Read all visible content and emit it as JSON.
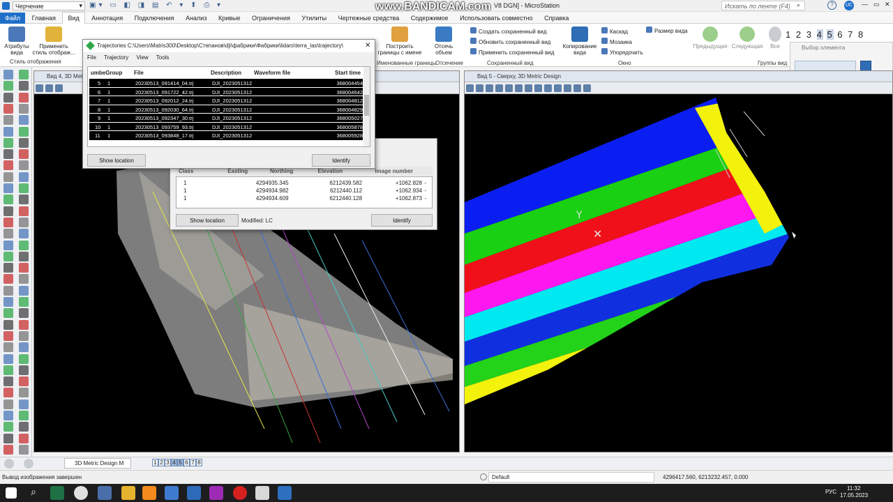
{
  "titlebar": {
    "workflow": "Черчение",
    "title": "V8 DGN] - MicroStation",
    "watermark": "www.BANDICAM.com",
    "search_placeholder": "Искать по ленте (F4)",
    "user": "UC"
  },
  "ribbon_tabs": [
    "Файл",
    "Главная",
    "Вид",
    "Аннотация",
    "Подключения",
    "Анализ",
    "Кривые",
    "Ограничения",
    "Утилиты",
    "Чертежные средства",
    "Содержимое",
    "Использовать совместно",
    "Справка"
  ],
  "ribbon": {
    "attrs_btn": "Атрибуты вида",
    "apply_style_btn": "Применить стиль отображ...",
    "display_style_group": "Стиль отображения",
    "build_bounds_btn": "Построить границы с имене",
    "named_bounds_group": "Именованные границы",
    "clip_btn": "Отсечь объем",
    "clip_group": "Отсечение",
    "create_saved": "Создать сохраненный вид",
    "update_saved": "Обновить сохраненный вид",
    "apply_saved": "Применить сохраненный вид",
    "saved_group": "Сохраненный вид",
    "copy_view": "Копирование вида",
    "cascade": "Каскад",
    "mosaic": "Мозаика",
    "arrange": "Упорядочить",
    "view_size": "Размер вида",
    "window_group": "Окно",
    "prev": "Предыдущая",
    "next": "Следующая",
    "all": "Все",
    "view_groups": "Группы вид",
    "view_numbers": [
      "1",
      "2",
      "3",
      "4",
      "5",
      "6",
      "7",
      "8"
    ],
    "select_element": "Выбор элемента"
  },
  "view4": {
    "title": "Вид 4, 3D Metric"
  },
  "view5": {
    "title": "Вид 5 - Сверху, 3D Metric Design"
  },
  "trajectories": {
    "title": "Trajectories C:\\Users\\Matris300\\Desktop\\Степанов\\dji\\фабрики\\Фабрики\\lidars\\terra_las\\trajectory\\",
    "menu": [
      "File",
      "Trajectory",
      "View",
      "Tools"
    ],
    "columns": [
      "umbeGroup",
      "File",
      "Description",
      "Waveform file",
      "Start time"
    ],
    "rows": [
      {
        "num": "5",
        "group": "1",
        "file": "20230513_091414_04.trj",
        "desc": "DJI_2023051312",
        "wave": "",
        "start": "368004454"
      },
      {
        "num": "6",
        "group": "1",
        "file": "20230513_091722_42.trj",
        "desc": "DJI_2023051312",
        "wave": "",
        "start": "368004642"
      },
      {
        "num": "7",
        "group": "1",
        "file": "20230513_092012_24.trj",
        "desc": "DJI_2023051312",
        "wave": "",
        "start": "368004812"
      },
      {
        "num": "8",
        "group": "1",
        "file": "20230513_092030_64.trj",
        "desc": "DJI_2023051312",
        "wave": "",
        "start": "368004829"
      },
      {
        "num": "9",
        "group": "1",
        "file": "20230513_092347_30.trj",
        "desc": "DJI_2023051312",
        "wave": "",
        "start": "368005027"
      },
      {
        "num": "10",
        "group": "1",
        "file": "20230513_093759_93.trj",
        "desc": "DJI_2023051312",
        "wave": "",
        "start": "368005878"
      },
      {
        "num": "11",
        "group": "1",
        "file": "20230513_093848_17.trj",
        "desc": "DJI_2023051312",
        "wave": "",
        "start": "368005928"
      }
    ],
    "show_location": "Show location",
    "identify": "Identify"
  },
  "identify": {
    "columns": [
      "Class",
      "Easting",
      "Northing",
      "Elevation",
      "Image number"
    ],
    "rows": [
      {
        "cls": "1",
        "e": "4294935.345",
        "n": "6212439.582",
        "z": "+1062.828",
        "img": "-"
      },
      {
        "cls": "1",
        "e": "4294934.982",
        "n": "6212440.112",
        "z": "+1062.934",
        "img": "-"
      },
      {
        "cls": "1",
        "e": "4294934.609",
        "n": "6212440.128",
        "z": "+1062.873",
        "img": "-"
      }
    ],
    "show_location": "Show location",
    "modified": "Modified: LC",
    "identify": "Identify"
  },
  "viewctl": {
    "model": "3D Metric Design M",
    "views": [
      "1",
      "2",
      "3",
      "4",
      "5",
      "6",
      "7",
      "8"
    ]
  },
  "status": {
    "message": "Вывод изображения завершен",
    "level": "Default",
    "coords": "4296417.560, 6213232.457, 0.000"
  },
  "taskbar": {
    "lang": "РУС",
    "time": "11:32",
    "date": "17.05.2023"
  },
  "colors": {
    "accent": "#1f6fc9",
    "selection": "#000000",
    "viewbg": "#000000"
  }
}
